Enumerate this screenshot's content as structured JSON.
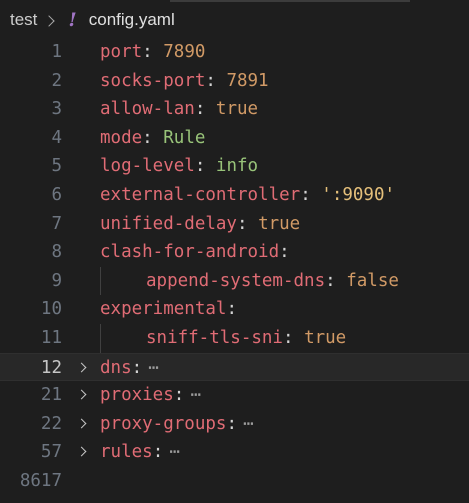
{
  "breadcrumb": {
    "folder": "test",
    "file_icon": "!",
    "file": "config.yaml"
  },
  "colors": {
    "background": "#1e1e1e",
    "key": "#e06c75",
    "number": "#d19a66",
    "string": "#98c379",
    "quoted_string": "#e5c07b",
    "line_number": "#6e7681",
    "yaml_icon": "#a074c4"
  },
  "lines": [
    {
      "num": "1",
      "key": "port",
      "sep": ":",
      "value": "7890",
      "type": "num"
    },
    {
      "num": "2",
      "key": "socks-port",
      "sep": ":",
      "value": "7891",
      "type": "num"
    },
    {
      "num": "3",
      "key": "allow-lan",
      "sep": ":",
      "value": "true",
      "type": "bool"
    },
    {
      "num": "4",
      "key": "mode",
      "sep": ":",
      "value": "Rule",
      "type": "str"
    },
    {
      "num": "5",
      "key": "log-level",
      "sep": ":",
      "value": "info",
      "type": "str"
    },
    {
      "num": "6",
      "key": "external-controller",
      "sep": ":",
      "value": "':9090'",
      "type": "str-q"
    },
    {
      "num": "7",
      "key": "unified-delay",
      "sep": ":",
      "value": "true",
      "type": "bool"
    },
    {
      "num": "8",
      "key": "clash-for-android",
      "sep": ":",
      "value": "",
      "type": ""
    },
    {
      "num": "9",
      "key": "append-system-dns",
      "sep": ":",
      "value": "false",
      "type": "bool",
      "indent": true
    },
    {
      "num": "10",
      "key": "experimental",
      "sep": ":",
      "value": "",
      "type": ""
    },
    {
      "num": "11",
      "key": "sniff-tls-sni",
      "sep": ":",
      "value": "true",
      "type": "bool",
      "indent": true
    },
    {
      "num": "12",
      "key": "dns",
      "sep": ":",
      "ellipsis": "⋯",
      "folded": true,
      "current": true
    },
    {
      "num": "21",
      "key": "proxies",
      "sep": ":",
      "ellipsis": "⋯",
      "folded": true
    },
    {
      "num": "22",
      "key": "proxy-groups",
      "sep": ":",
      "ellipsis": "⋯",
      "folded": true
    },
    {
      "num": "57",
      "key": "rules",
      "sep": ":",
      "ellipsis": "⋯",
      "folded": true
    },
    {
      "num": "8617",
      "key": "",
      "sep": ""
    }
  ]
}
